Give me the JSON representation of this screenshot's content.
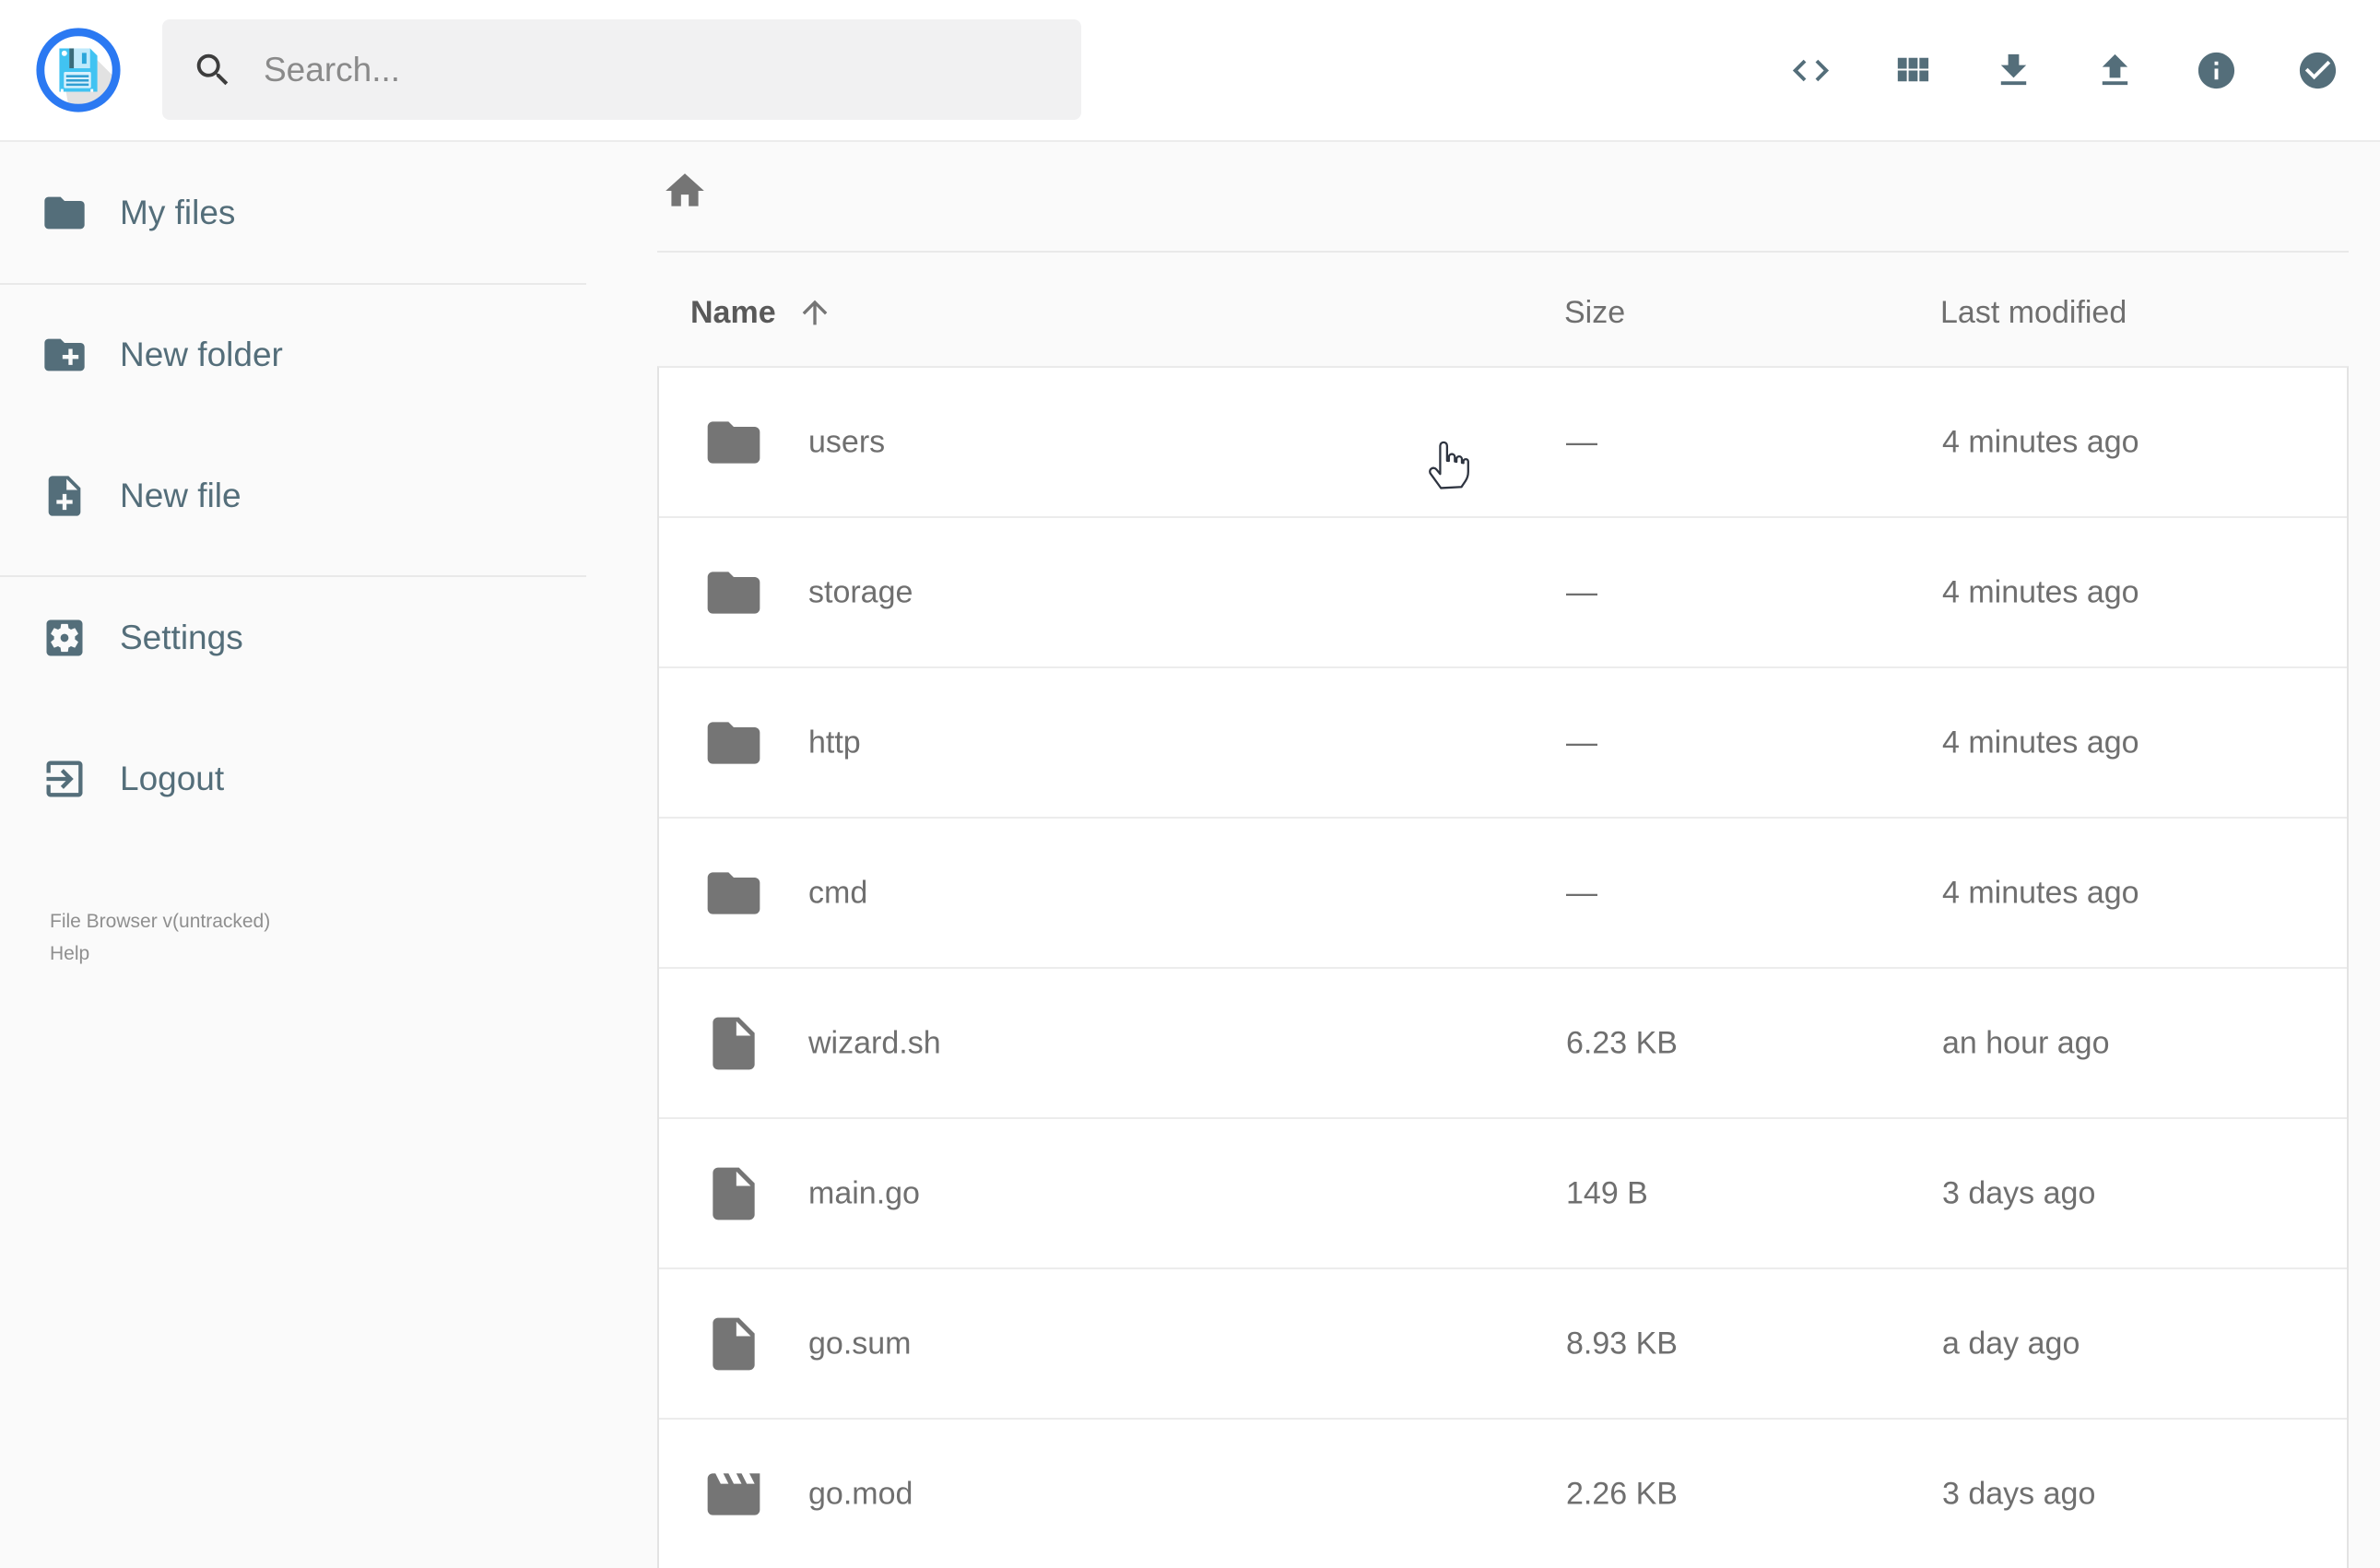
{
  "app": {
    "name": "File Browser",
    "colors": {
      "accent_slate": "#546e7a",
      "logo_ring_blue": "#2b79f2",
      "logo_floppy_blue": "#41c3f2",
      "row_icon_gray": "#757575",
      "row_text_gray": "#6f6f6f",
      "background": "#fafafa"
    }
  },
  "header": {
    "logo_icon": "floppy-disk-logo-icon",
    "search": {
      "placeholder": "Search...",
      "icon": "search-icon",
      "value": ""
    },
    "toolbar": [
      {
        "name": "shell-toggle-button",
        "icon": "code-icon"
      },
      {
        "name": "switch-view-button",
        "icon": "grid-view-icon"
      },
      {
        "name": "download-button",
        "icon": "download-icon"
      },
      {
        "name": "upload-button",
        "icon": "upload-icon"
      },
      {
        "name": "info-button",
        "icon": "info-icon"
      },
      {
        "name": "select-multiple-button",
        "icon": "check-circle-icon"
      }
    ]
  },
  "sidebar": {
    "items": [
      {
        "label": "My files",
        "icon": "folder-icon"
      },
      {
        "label": "New folder",
        "icon": "new-folder-icon"
      },
      {
        "label": "New file",
        "icon": "new-file-icon"
      },
      {
        "label": "Settings",
        "icon": "settings-icon"
      },
      {
        "label": "Logout",
        "icon": "logout-icon"
      }
    ],
    "footer": {
      "version": "File Browser v(untracked)",
      "help": "Help"
    }
  },
  "breadcrumb": {
    "home_icon": "home-icon"
  },
  "listing": {
    "columns": [
      {
        "label": "Name",
        "sorted": "asc",
        "icon": "arrow-up-icon"
      },
      {
        "label": "Size"
      },
      {
        "label": "Last modified"
      }
    ],
    "rows": [
      {
        "name": "users",
        "icon": "folder-icon",
        "size": "—",
        "modified": "4 minutes ago"
      },
      {
        "name": "storage",
        "icon": "folder-icon",
        "size": "—",
        "modified": "4 minutes ago"
      },
      {
        "name": "http",
        "icon": "folder-icon",
        "size": "—",
        "modified": "4 minutes ago"
      },
      {
        "name": "cmd",
        "icon": "folder-icon",
        "size": "—",
        "modified": "4 minutes ago"
      },
      {
        "name": "wizard.sh",
        "icon": "file-icon",
        "size": "6.23 KB",
        "modified": "an hour ago"
      },
      {
        "name": "main.go",
        "icon": "file-icon",
        "size": "149 B",
        "modified": "3 days ago"
      },
      {
        "name": "go.sum",
        "icon": "file-icon",
        "size": "8.93 KB",
        "modified": "a day ago"
      },
      {
        "name": "go.mod",
        "icon": "movie-icon",
        "size": "2.26 KB",
        "modified": "3 days ago"
      }
    ]
  },
  "ui_state": {
    "cursor": "hand-pointer over users row"
  }
}
